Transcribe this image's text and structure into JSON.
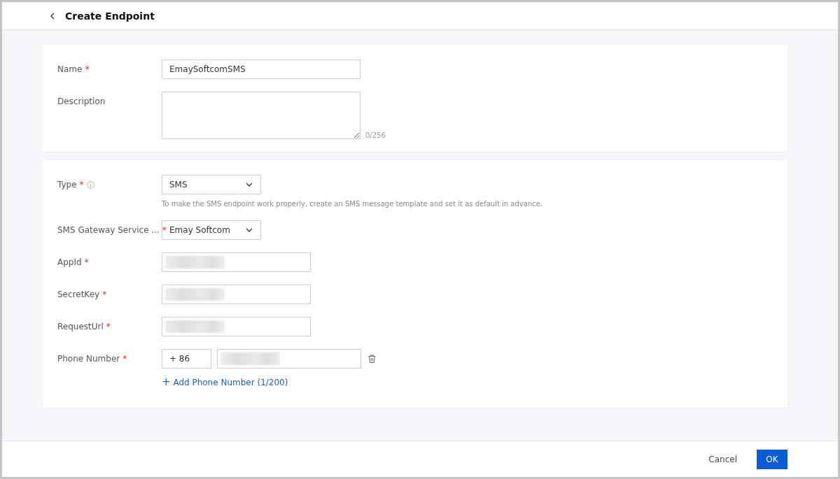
{
  "header": {
    "title": "Create Endpoint"
  },
  "basic": {
    "fields": [
      {
        "kind": "input",
        "label": "Name",
        "required_mark": "*",
        "value": "EmaySoftcomSMS"
      },
      {
        "kind": "textarea",
        "label": "Description",
        "counter": "0/256"
      }
    ]
  },
  "config": {
    "fields": [
      {
        "kind": "select",
        "label": "Type",
        "required_mark": "*",
        "info": true,
        "value": "SMS",
        "hint": "To make the SMS endpoint work properly, create an SMS message template and set it as default in advance."
      },
      {
        "kind": "select",
        "label": "SMS Gateway Service ...",
        "required_mark": "*",
        "value": "Emay Softcom"
      },
      {
        "kind": "masked",
        "label": "AppId",
        "required_mark": "*"
      },
      {
        "kind": "masked",
        "label": "SecretKey",
        "required_mark": "*"
      },
      {
        "kind": "masked",
        "label": "RequestUrl",
        "required_mark": "*"
      },
      {
        "kind": "phone",
        "label": "Phone Number",
        "required_mark": "*",
        "code": "+ 86",
        "add_icon": "+",
        "add_label": "Add Phone Number (1/200)"
      }
    ]
  },
  "footer": {
    "buttons": [
      {
        "label": "Cancel",
        "kind": "secondary"
      },
      {
        "label": "OK",
        "kind": "primary"
      }
    ]
  }
}
